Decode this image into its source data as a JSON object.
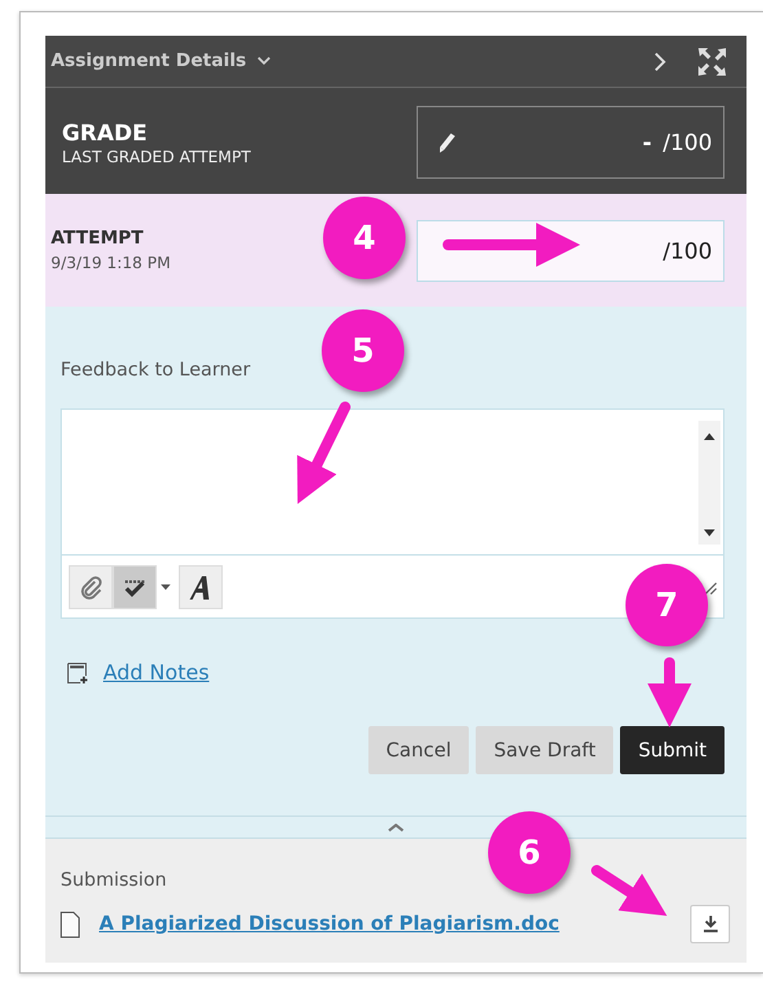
{
  "header": {
    "title": "Assignment Details"
  },
  "grade": {
    "title": "GRADE",
    "subtitle": "LAST GRADED ATTEMPT",
    "value": "-",
    "max": "/100"
  },
  "attempt": {
    "title": "ATTEMPT",
    "date": "9/3/19 1:18 PM",
    "max": "/100"
  },
  "feedback": {
    "label": "Feedback to Learner",
    "toolbar": [
      {
        "kind": "attach",
        "selected": false
      },
      {
        "kind": "spellcheck",
        "selected": true
      },
      {
        "kind": "font",
        "selected": false
      }
    ]
  },
  "add_notes": "Add Notes",
  "buttons": [
    {
      "label": "Cancel",
      "kind": "secondary"
    },
    {
      "label": "Save Draft",
      "kind": "secondary"
    },
    {
      "label": "Submit",
      "kind": "primary"
    }
  ],
  "submission": {
    "label": "Submission",
    "file": "A Plagiarized Discussion of Plagiarism.doc"
  },
  "callouts": [
    {
      "number": "4"
    },
    {
      "number": "5"
    },
    {
      "number": "7"
    },
    {
      "number": "6"
    }
  ]
}
